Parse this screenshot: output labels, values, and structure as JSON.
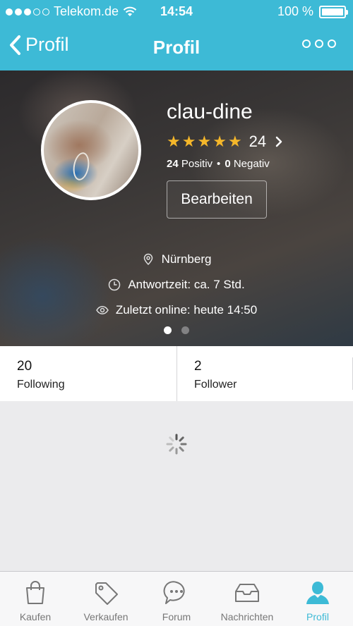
{
  "status_bar": {
    "carrier": "Telekom.de",
    "time": "14:54",
    "battery": "100 %"
  },
  "nav": {
    "back_label": "Profil",
    "title": "Profil"
  },
  "profile": {
    "username": "clau-dine",
    "rating_stars": 5,
    "rating_count": "24",
    "positive_count": "24",
    "positive_label": "Positiv",
    "negative_count": "0",
    "negative_label": "Negativ",
    "edit_label": "Bearbeiten",
    "location": "Nürnberg",
    "response_time": "Antwortzeit: ca. 7 Std.",
    "last_online": "Zuletzt online: heute 14:50"
  },
  "stats": {
    "following_count": "20",
    "following_label": "Following",
    "follower_count": "2",
    "follower_label": "Follower"
  },
  "tabs": [
    {
      "label": "Kaufen",
      "icon": "bag-icon"
    },
    {
      "label": "Verkaufen",
      "icon": "tag-icon"
    },
    {
      "label": "Forum",
      "icon": "chat-icon"
    },
    {
      "label": "Nachrichten",
      "icon": "inbox-icon"
    },
    {
      "label": "Profil",
      "icon": "person-icon"
    }
  ],
  "colors": {
    "accent": "#3dbad6",
    "star": "#f5b72a"
  }
}
